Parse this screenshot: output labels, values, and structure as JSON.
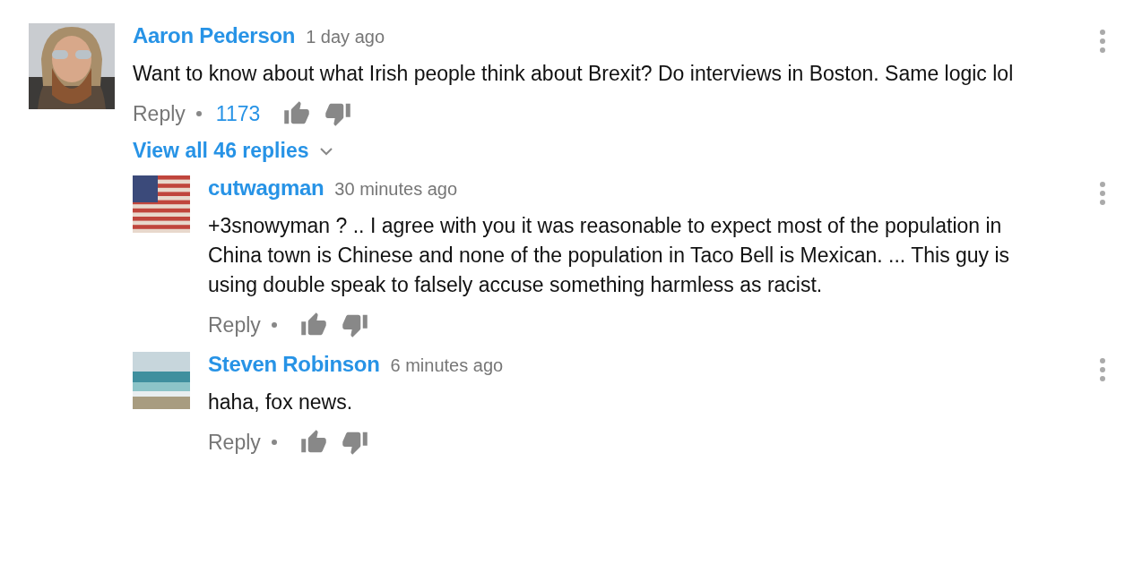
{
  "comments": [
    {
      "author": "Aaron Pederson",
      "time": "1 day ago",
      "text": "Want to know about what Irish people think about Brexit? Do interviews in Boston. Same logic lol",
      "reply_label": "Reply",
      "likes": "1173",
      "view_replies": "View all 46 replies",
      "replies": [
        {
          "author": "cutwagman",
          "time": "30 minutes ago",
          "text": "+3snowyman ? .. I agree with you it was reasonable to expect most of the population in China town is Chinese and none of the population in Taco Bell is Mexican. ... This guy is using double speak to falsely accuse something harmless as racist.",
          "reply_label": "Reply",
          "avatar": {
            "kind": "flag"
          }
        },
        {
          "author": "Steven Robinson",
          "time": "6 minutes ago",
          "text": "haha, fox news.",
          "reply_label": "Reply",
          "avatar": {
            "kind": "beach"
          }
        }
      ]
    }
  ]
}
